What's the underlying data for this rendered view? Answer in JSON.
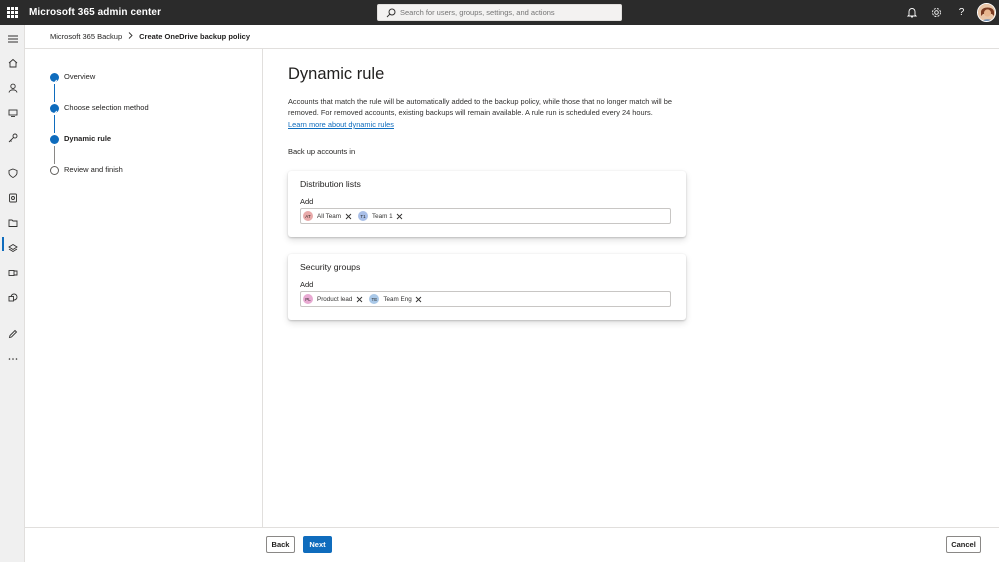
{
  "topbar": {
    "app_title": "Microsoft 365 admin center",
    "search_placeholder": "Search for users, groups, settings, and actions",
    "icons": [
      "waffle-icon",
      "bell-icon",
      "gear-icon",
      "help-icon",
      "avatar"
    ]
  },
  "leftnav": {
    "icons": [
      "hamburger-icon",
      "home-icon",
      "user-icon",
      "devices-icon",
      "key-icon",
      "shield-icon",
      "settings-icon",
      "backup-icon",
      "layers-icon",
      "exchange-icon",
      "sharepoint-icon",
      "pen-icon",
      "more-icon"
    ]
  },
  "breadcrumb": {
    "parent": "Microsoft 365 Backup",
    "current": "Create OneDrive backup policy"
  },
  "steps": [
    {
      "label": "Overview",
      "state": "done"
    },
    {
      "label": "Choose selection method",
      "state": "done"
    },
    {
      "label": "Dynamic rule",
      "state": "active"
    },
    {
      "label": "Review and finish",
      "state": "todo"
    }
  ],
  "main": {
    "title": "Dynamic rule",
    "description": "Accounts that match the rule will be automatically added to the backup policy, while those that no longer match will be removed. For removed accounts, existing backups will remain available. A rule run is scheduled every 24 hours.",
    "learn_more": "Learn more about dynamic rules",
    "backup_label": "Back up accounts in"
  },
  "cards": {
    "distribution": {
      "title": "Distribution lists",
      "add_label": "Add",
      "chips": [
        {
          "initials": "AT",
          "name": "All Team",
          "color": "#e8a9a9"
        },
        {
          "initials": "T1",
          "name": "Team 1",
          "color": "#a9bfe8"
        }
      ]
    },
    "security": {
      "title": "Security groups",
      "add_label": "Add",
      "chips": [
        {
          "initials": "PL",
          "name": "Product lead",
          "color": "#e8a9d2"
        },
        {
          "initials": "TE",
          "name": "Team Eng",
          "color": "#a9c8e8"
        }
      ]
    }
  },
  "footer": {
    "back": "Back",
    "next": "Next",
    "cancel": "Cancel"
  },
  "colors": {
    "accent": "#0f6cbd",
    "topbar": "#2b2b2b"
  }
}
